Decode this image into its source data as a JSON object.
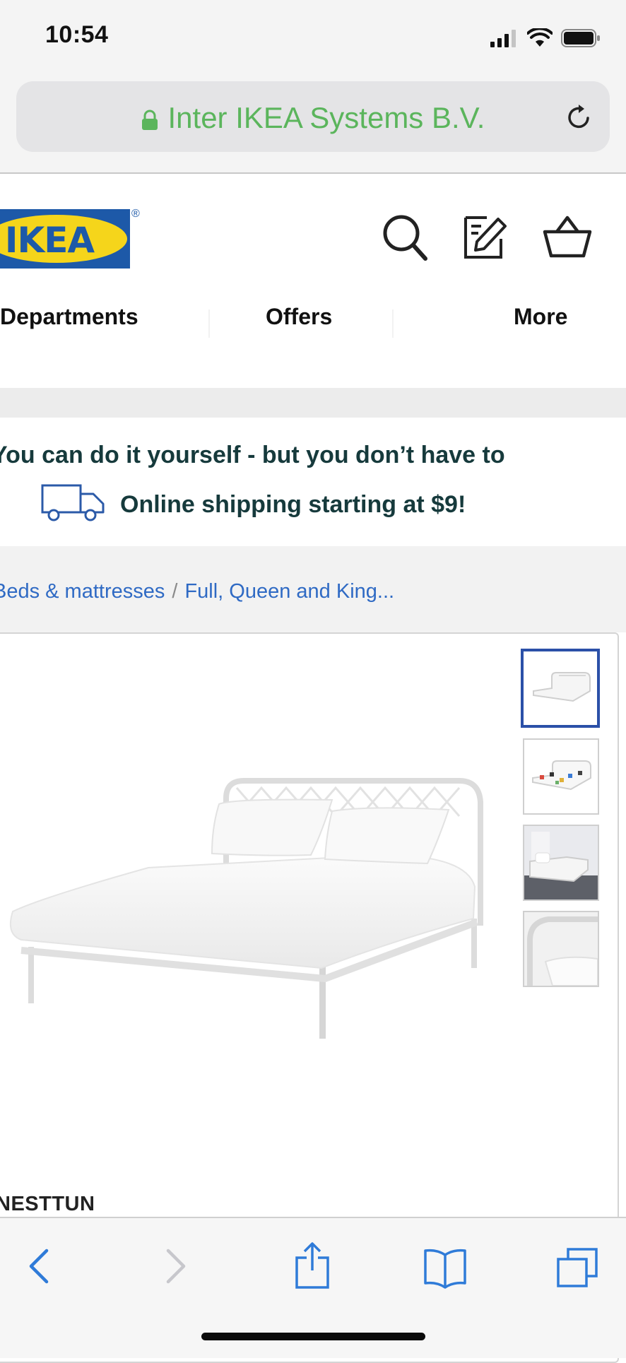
{
  "status_bar": {
    "time": "10:54"
  },
  "address_bar": {
    "site": "Inter IKEA Systems B.V."
  },
  "header": {
    "logo_text": "IKEA",
    "registered": "®"
  },
  "nav": {
    "items": [
      "Departments",
      "Offers",
      "More"
    ]
  },
  "promo": {
    "line1": "You can do it yourself - but you don’t have to",
    "line2": "Online shipping starting at $9!"
  },
  "breadcrumb": {
    "items": [
      "Beds & mattresses",
      "Full, Queen and King..."
    ],
    "separator": "/"
  },
  "product": {
    "name": "NESTTUN",
    "thumbnail_count": 4,
    "active_thumbnail": 1
  },
  "colors": {
    "address_green": "#5bb55c",
    "link_blue": "#2f6ac4",
    "ikea_blue": "#1d59a8",
    "ikea_yellow": "#f5d51b",
    "promo_text": "#163a3c",
    "ios_blue": "#2f7bd8"
  },
  "icons": {
    "status": [
      "cellular-signal-icon",
      "wifi-icon",
      "battery-icon"
    ],
    "address": [
      "lock-icon",
      "reload-icon"
    ],
    "header": [
      "search-icon",
      "edit-list-icon",
      "shopping-bag-icon"
    ],
    "promo": "delivery-truck-icon",
    "toolbar": [
      "back-icon",
      "forward-icon",
      "share-icon",
      "bookmarks-icon",
      "tabs-icon"
    ]
  }
}
